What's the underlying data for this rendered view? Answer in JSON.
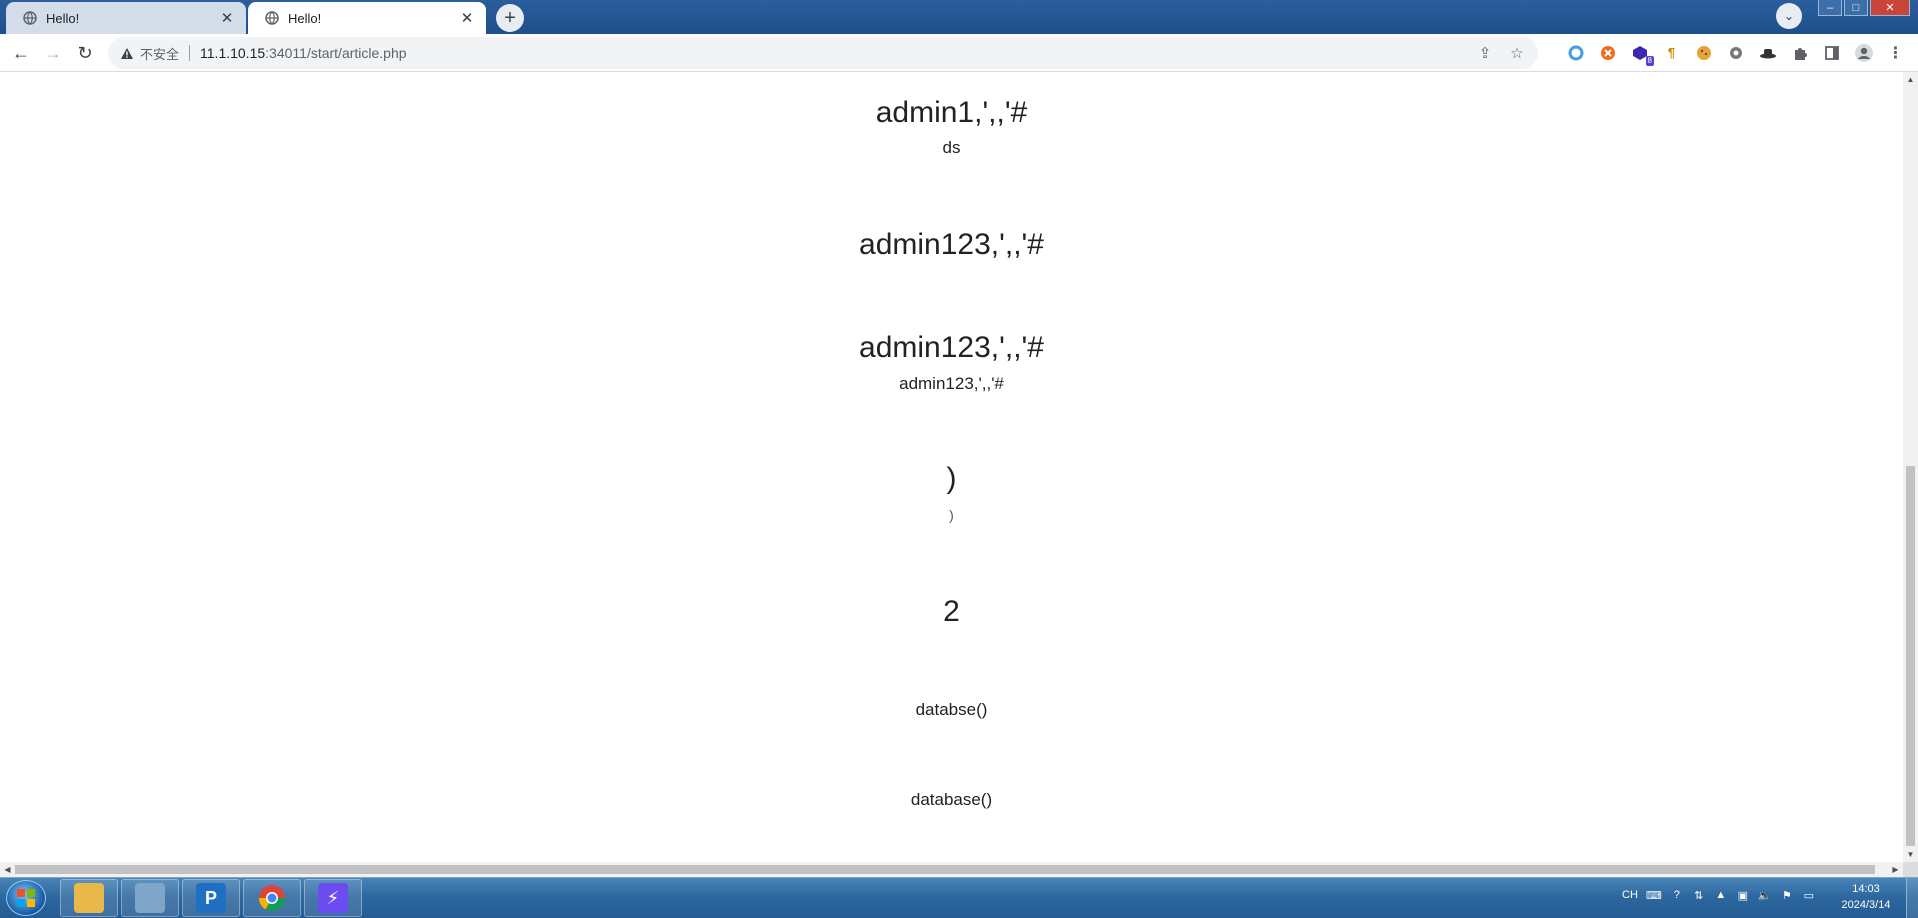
{
  "browser": {
    "tabs": [
      {
        "title": "Hello!",
        "active": false
      },
      {
        "title": "Hello!",
        "active": true
      }
    ],
    "new_tab_label": "+",
    "address": {
      "security_label": "不安全",
      "host": "11.1.10.15",
      "path": ":34011/start/article.php"
    }
  },
  "page": {
    "entries": [
      {
        "heading": "admin1,',,'#",
        "sub": "ds"
      },
      {
        "heading": "admin123,',,'#",
        "sub": ""
      },
      {
        "heading": "admin123,',,'#",
        "sub": "admin123,',,'#"
      },
      {
        "heading": ")",
        "sub": ")"
      },
      {
        "heading": "2",
        "sub": ""
      },
      {
        "heading": "",
        "sub": "databse()"
      },
      {
        "heading": "",
        "sub": "database()"
      }
    ]
  },
  "taskbar": {
    "apps": [
      {
        "name": "file-explorer",
        "color": "#e8b94a"
      },
      {
        "name": "notepad",
        "color": "#7fa6c8"
      },
      {
        "name": "p-app",
        "color": "#1f6fc4",
        "glyph": "P"
      },
      {
        "name": "chrome",
        "color": "#ffffff"
      },
      {
        "name": "bolt-app",
        "color": "#6a4cf0",
        "glyph": "⚡"
      }
    ],
    "tray": {
      "language": "CH"
    },
    "clock": {
      "time": "14:03",
      "date": "2024/3/14"
    }
  }
}
